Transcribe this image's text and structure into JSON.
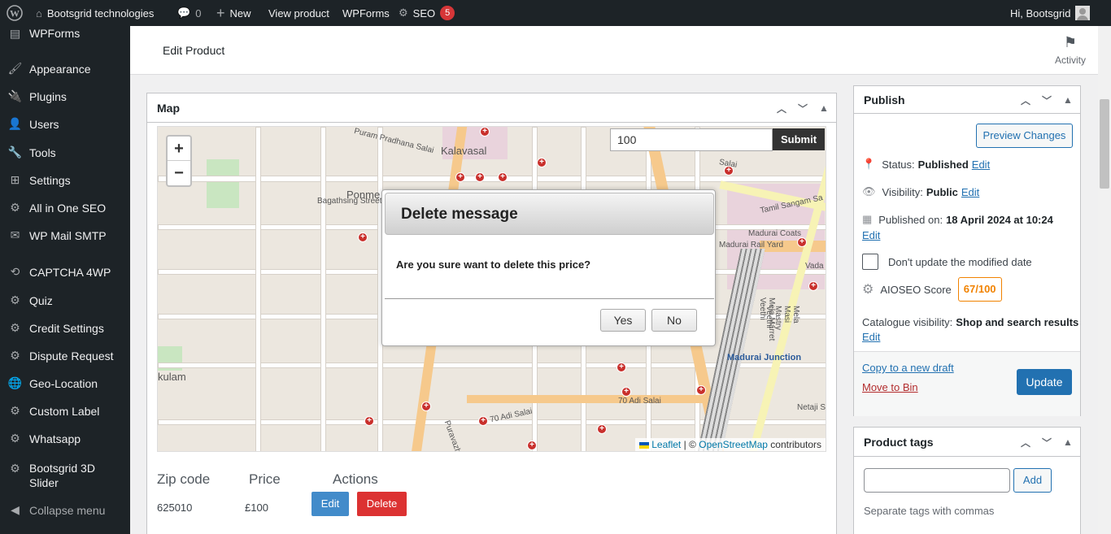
{
  "adminbar": {
    "site_name": "Bootsgrid technologies",
    "comments_count": "0",
    "new_label": "New",
    "view_product": "View product",
    "wpforms": "WPForms",
    "seo_label": "SEO",
    "seo_badge": "5",
    "greeting": "Hi, Bootsgrid"
  },
  "sidebar": {
    "items": [
      {
        "label": "WPForms",
        "icon": "wpforms-icon"
      },
      {
        "label": "Appearance",
        "icon": "paintbrush-icon"
      },
      {
        "label": "Plugins",
        "icon": "plugin-icon"
      },
      {
        "label": "Users",
        "icon": "user-icon"
      },
      {
        "label": "Tools",
        "icon": "wrench-icon"
      },
      {
        "label": "Settings",
        "icon": "settings-icon"
      },
      {
        "label": "All in One SEO",
        "icon": "aioseo-icon"
      },
      {
        "label": "WP Mail SMTP",
        "icon": "mail-icon"
      },
      {
        "label": "CAPTCHA 4WP",
        "icon": "captcha-icon"
      },
      {
        "label": "Quiz",
        "icon": "gear-icon"
      },
      {
        "label": "Credit Settings",
        "icon": "gear-icon"
      },
      {
        "label": "Dispute Request",
        "icon": "gear-icon"
      },
      {
        "label": "Geo-Location",
        "icon": "globe-icon"
      },
      {
        "label": "Custom Label",
        "icon": "gear-icon"
      },
      {
        "label": "Whatsapp",
        "icon": "gear-icon"
      },
      {
        "label": "Bootsgrid 3D Slider",
        "icon": "gear-icon"
      }
    ],
    "collapse_label": "Collapse menu"
  },
  "header": {
    "title": "Edit Product",
    "activity_label": "Activity"
  },
  "map_box": {
    "title": "Map",
    "search_value": "100",
    "submit_label": "Submit",
    "zoom_in": "+",
    "zoom_out": "−",
    "attribution_leaflet": "Leaflet",
    "attribution_sep": "| ©",
    "attribution_osm": "OpenStreetMap",
    "attribution_tail": "contributors",
    "labels": {
      "kalavasal": "Kalavasal",
      "ponme": "Ponme",
      "bagathsing": "Bagathsing Street",
      "madurai_coats": "Madurai Coats",
      "madurai_junction": "Madurai Junction",
      "adi_salai_1": "70 Adi Salai",
      "adi_salai_2": "70 Adi Salai",
      "tamil_sangam": "Tamil Sangam Sa",
      "vada": "Vada",
      "kulam": "kulam",
      "netaji": "Netaji S",
      "purathana": "Puram Pradhana Salai",
      "salai": "Salai",
      "madurai_rail_yard": "Madurai Rail Yard",
      "mela_marret": "Mela Marret Veethi",
      "mela_masi": "Mela Masi Mastry Veethi",
      "puravazhi": "Puravazhi S"
    }
  },
  "table": {
    "headers": [
      "Zip code",
      "Price",
      "Actions"
    ],
    "rows": [
      {
        "zip": "625010",
        "price": "£100"
      }
    ],
    "edit_label": "Edit",
    "delete_label": "Delete"
  },
  "modal": {
    "title": "Delete message",
    "message": "Are you sure want to delete this price?",
    "yes_label": "Yes",
    "no_label": "No"
  },
  "publish": {
    "title": "Publish",
    "preview_label": "Preview Changes",
    "status_label": "Status:",
    "status_value": "Published",
    "visibility_label": "Visibility:",
    "visibility_value": "Public",
    "published_on_label": "Published on:",
    "published_on_value": "18 April 2024 at 10:24",
    "edit_label": "Edit",
    "dont_update_label": "Don't update the modified date",
    "aioseo_label": "AIOSEO Score",
    "aioseo_score": "67/100",
    "catalogue_label": "Catalogue visibility:",
    "catalogue_value": "Shop and search results",
    "copy_draft": "Copy to a new draft",
    "move_bin": "Move to Bin",
    "update_label": "Update"
  },
  "tags": {
    "title": "Product tags",
    "add_label": "Add",
    "hint": "Separate tags with commas"
  },
  "colors": {
    "accent": "#2271b1",
    "delete": "#dc3232",
    "edit": "#428bca",
    "score": "#f18200",
    "adminbar": "#1d2327"
  }
}
